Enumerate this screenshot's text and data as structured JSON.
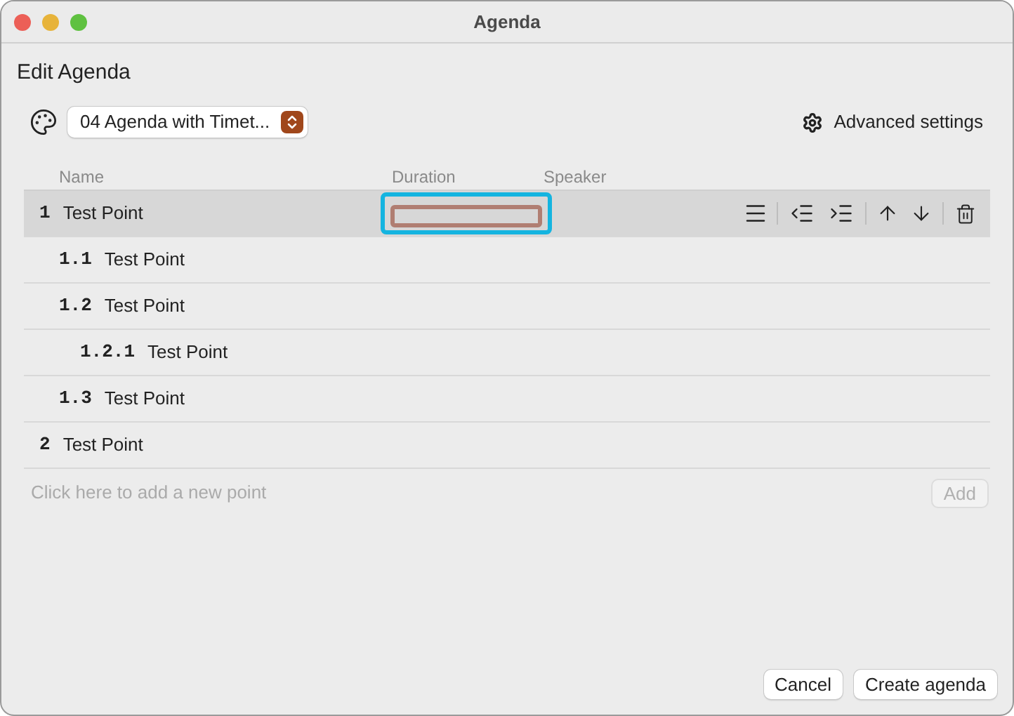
{
  "window": {
    "title": "Agenda"
  },
  "heading": "Edit Agenda",
  "template": {
    "value": "04 Agenda with Timet..."
  },
  "advanced_settings": "Advanced settings",
  "table": {
    "columns": [
      "Name",
      "Duration",
      "Speaker"
    ],
    "points": [
      {
        "number": "1",
        "name": "Test Point",
        "selected": true,
        "duration_focused": true,
        "children": [
          {
            "number": "1.1",
            "name": "Test Point",
            "selected": false
          },
          {
            "number": "1.2",
            "name": "Test Point",
            "selected": false,
            "children": [
              {
                "number": "1.2.1",
                "name": "Test Point",
                "selected": false
              }
            ]
          },
          {
            "number": "1.3",
            "name": "Test Point",
            "selected": false
          }
        ]
      },
      {
        "number": "2",
        "name": "Test Point",
        "selected": false
      }
    ]
  },
  "new_point": {
    "placeholder": "Click here to add a new point"
  },
  "add_button": {
    "label": "Add",
    "disabled": true
  },
  "buttons": [
    "Cancel",
    "Create agenda"
  ]
}
